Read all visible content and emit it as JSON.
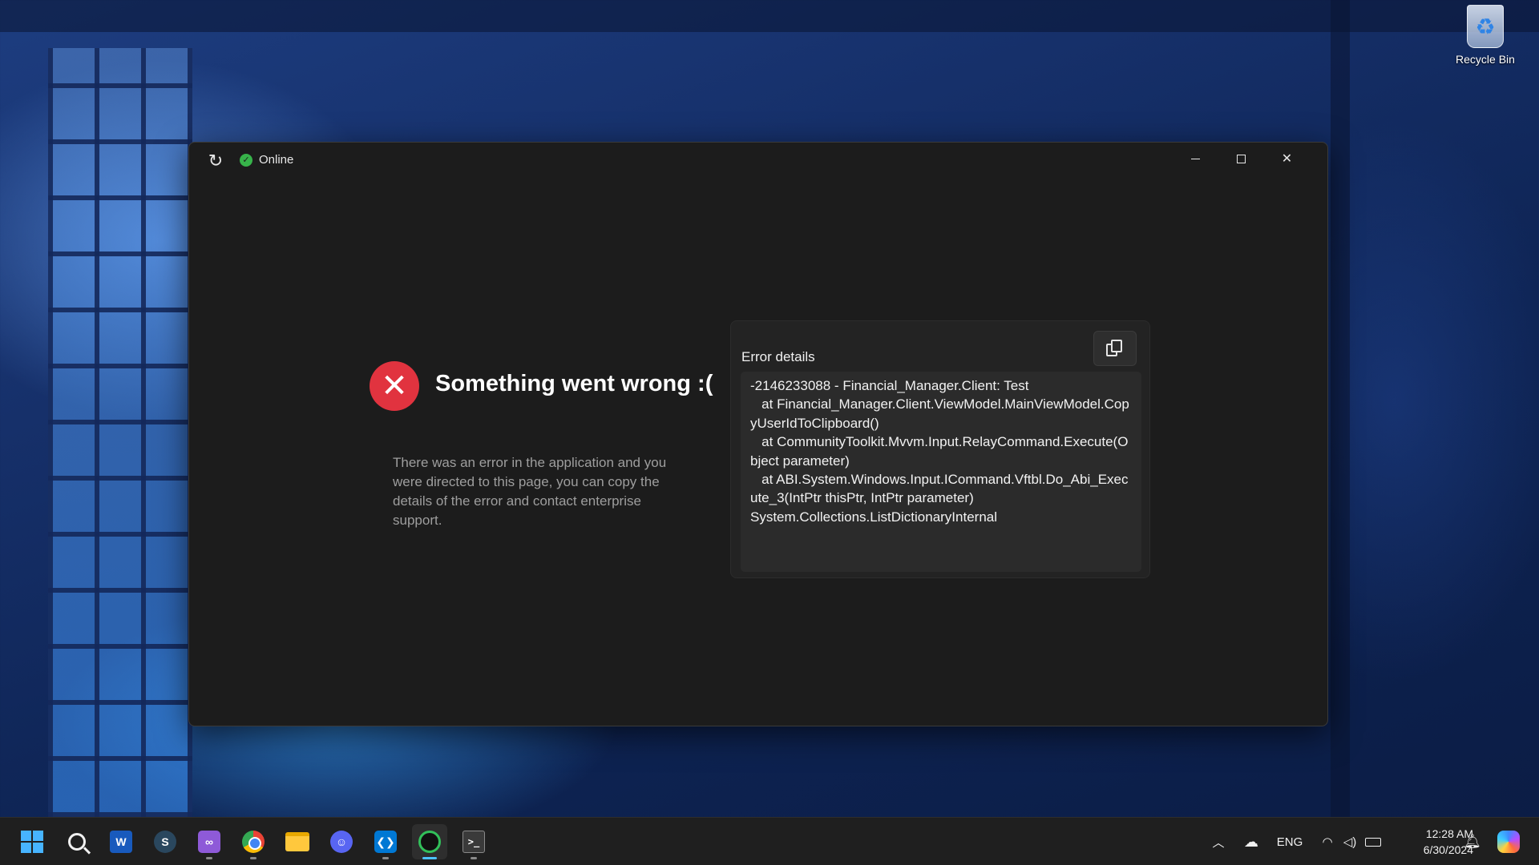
{
  "desktop": {
    "recycle_bin_label": "Recycle Bin"
  },
  "window": {
    "status_label": "Online",
    "controls": {
      "minimize": "minimize-icon",
      "maximize": "maximize-icon",
      "close": "close-icon"
    }
  },
  "error": {
    "title": "Something went wrong :(",
    "description": "There was an error in the application and you were directed to this page, you can copy the details of the error and contact enterprise support.",
    "details_title": "Error details",
    "details_text": "-2146233088 - Financial_Manager.Client: Test\n   at Financial_Manager.Client.ViewModel.MainViewModel.CopyUserIdToClipboard()\n   at CommunityToolkit.Mvvm.Input.RelayCommand.Execute(Object parameter)\n   at ABI.System.Windows.Input.ICommand.Vftbl.Do_Abi_Execute_3(IntPtr thisPtr, IntPtr parameter)\nSystem.Collections.ListDictionaryInternal"
  },
  "taskbar": {
    "apps": [
      {
        "name": "Start",
        "icon": "windows-start-icon"
      },
      {
        "name": "Search",
        "icon": "search-icon"
      },
      {
        "name": "Word",
        "icon": "word-icon"
      },
      {
        "name": "Steam",
        "icon": "steam-icon"
      },
      {
        "name": "Visual Studio",
        "icon": "visual-studio-icon"
      },
      {
        "name": "Chrome",
        "icon": "chrome-icon"
      },
      {
        "name": "File Explorer",
        "icon": "folder-icon"
      },
      {
        "name": "Discord",
        "icon": "discord-icon"
      },
      {
        "name": "VS Code",
        "icon": "vscode-icon"
      },
      {
        "name": "Financial Manager",
        "icon": "app-icon"
      },
      {
        "name": "Terminal",
        "icon": "terminal-icon"
      }
    ],
    "tray": {
      "language": "ENG",
      "time": "12:28 AM",
      "date": "6/30/2024"
    }
  },
  "colors": {
    "accent": "#4cc2ff",
    "error_red": "#e1333f",
    "online_green": "#37b34a",
    "window_bg": "#1c1c1c"
  }
}
